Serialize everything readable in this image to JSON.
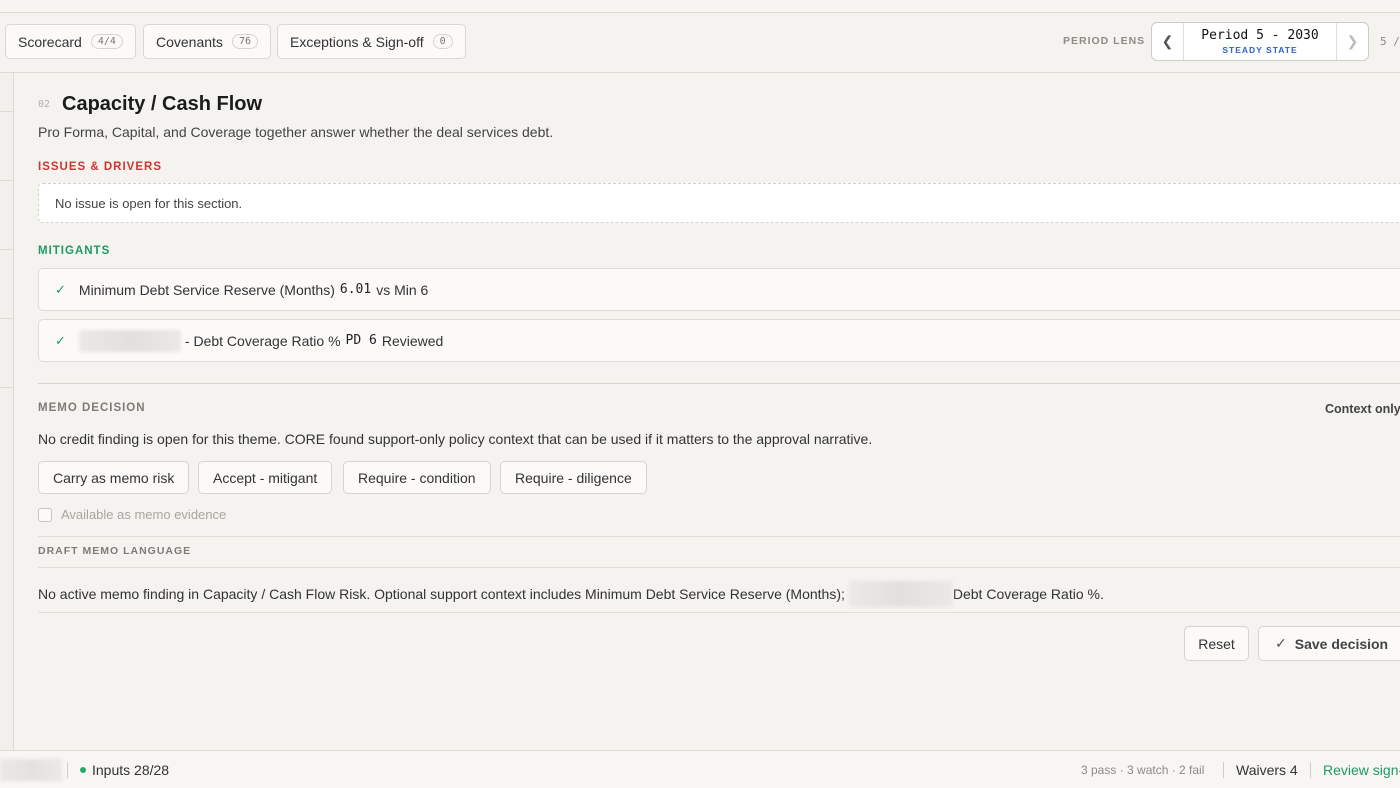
{
  "tabs": [
    {
      "label": "Scorecard",
      "count": "4/4"
    },
    {
      "label": "Covenants",
      "count": "76"
    },
    {
      "label": "Exceptions & Sign-off",
      "count": "0"
    }
  ],
  "period": {
    "lens_label": "PERIOD LENS",
    "value": "Period 5 - 2030",
    "sub": "STEADY STATE",
    "count": "5 /"
  },
  "section": {
    "number": "02",
    "title": "Capacity / Cash Flow",
    "description": "Pro Forma, Capital, and Coverage together answer whether the deal services debt.",
    "issues_label": "ISSUES & DRIVERS",
    "issues_empty": "No issue is open for this section.",
    "mitigants_label": "MITIGANTS",
    "mitigants": [
      {
        "prefix": "Minimum Debt Service Reserve (Months)",
        "value": "6.01",
        "suffix": "vs Min 6"
      },
      {
        "prefix": "- Debt Coverage Ratio %",
        "value": "PD 6",
        "suffix": "Reviewed"
      }
    ]
  },
  "memo": {
    "label": "MEMO DECISION",
    "context": "Context only",
    "text": "No credit finding is open for this theme. CORE found support-only policy context that can be used if it matters to the approval narrative.",
    "buttons": [
      "Carry as memo risk",
      "Accept - mitigant",
      "Require - condition",
      "Require - diligence"
    ],
    "checkbox_label": "Available as memo evidence",
    "draft_label": "DRAFT MEMO LANGUAGE",
    "draft_text_1": "No active memo finding in Capacity / Cash Flow Risk. Optional support context includes Minimum Debt Service Reserve (Months);",
    "draft_text_2": "Debt Coverage Ratio %.",
    "reset": "Reset",
    "save": "Save decision"
  },
  "footer": {
    "inputs": "Inputs 28/28",
    "stats": "3 pass · 3 watch · 2 fail",
    "waivers": "Waivers 4",
    "review": "Review sign-"
  },
  "icons": {
    "check": "check-icon",
    "prev": "chevron-left-icon",
    "next": "chevron-right-icon"
  },
  "colors": {
    "issues": "#d1342f",
    "mitigants": "#1f9a63",
    "period_sub": "#2f5fcf",
    "status_dot": "#27a86c"
  }
}
